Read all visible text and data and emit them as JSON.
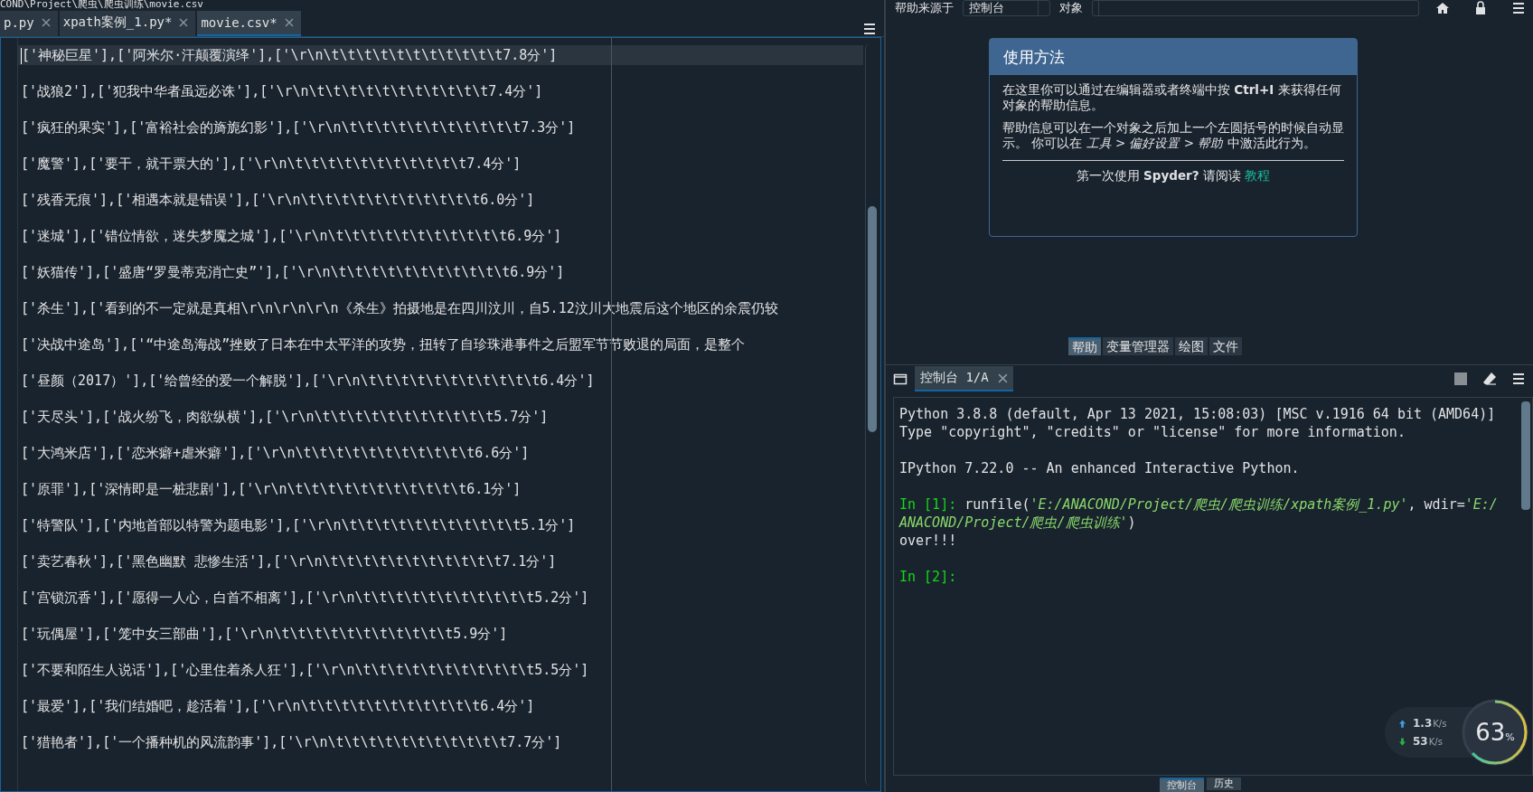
{
  "path_bar": "COND\\Project\\爬虫\\爬虫训练\\movie.csv",
  "editor": {
    "tabs": [
      {
        "label": "p.py",
        "selected": false
      },
      {
        "label": "xpath案例_1.py*",
        "selected": false
      },
      {
        "label": "movie.csv*",
        "selected": true
      }
    ],
    "lines": [
      {
        "text": "['神秘巨星'],['阿米尔·汗颠覆演绎'],['\\r\\n\\t\\t\\t\\t\\t\\t\\t\\t\\t\\t\\t7.8分']",
        "current": true
      },
      {
        "text": "['战狼2'],['犯我中华者虽远必诛'],['\\r\\n\\t\\t\\t\\t\\t\\t\\t\\t\\t\\t\\t7.4分']",
        "current": false
      },
      {
        "text": "['疯狂的果实'],['富裕社会的旖旎幻影'],['\\r\\n\\t\\t\\t\\t\\t\\t\\t\\t\\t\\t\\t7.3分']",
        "current": false
      },
      {
        "text": "['魔警'],['要干，就干票大的'],['\\r\\n\\t\\t\\t\\t\\t\\t\\t\\t\\t\\t\\t7.4分']",
        "current": false
      },
      {
        "text": "['残香无痕'],['相遇本就是错误'],['\\r\\n\\t\\t\\t\\t\\t\\t\\t\\t\\t\\t\\t6.0分']",
        "current": false
      },
      {
        "text": "['迷城'],['错位情欲，迷失梦魇之城'],['\\r\\n\\t\\t\\t\\t\\t\\t\\t\\t\\t\\t\\t6.9分']",
        "current": false
      },
      {
        "text": "['妖猫传'],['盛唐“罗曼蒂克消亡史”'],['\\r\\n\\t\\t\\t\\t\\t\\t\\t\\t\\t\\t\\t6.9分']",
        "current": false
      },
      {
        "text": "['杀生'],['看到的不一定就是真相\\r\\n\\r\\n\\r\\n《杀生》拍摄地是在四川汶川，自5.12汶川大地震后这个地区的余震仍较",
        "current": false
      },
      {
        "text": "['决战中途岛'],['“中途岛海战”挫败了日本在中太平洋的攻势，扭转了自珍珠港事件之后盟军节节败退的局面，是整个",
        "current": false
      },
      {
        "text": "['昼颜（2017）'],['给曾经的爱一个解脱'],['\\r\\n\\t\\t\\t\\t\\t\\t\\t\\t\\t\\t\\t6.4分']",
        "current": false
      },
      {
        "text": "['天尽头'],['战火纷飞，肉欲纵横'],['\\r\\n\\t\\t\\t\\t\\t\\t\\t\\t\\t\\t\\t5.7分']",
        "current": false
      },
      {
        "text": "['大鸿米店'],['恋米癖+虐米癖'],['\\r\\n\\t\\t\\t\\t\\t\\t\\t\\t\\t\\t\\t6.6分']",
        "current": false
      },
      {
        "text": "['原罪'],['深情即是一桩悲剧'],['\\r\\n\\t\\t\\t\\t\\t\\t\\t\\t\\t\\t\\t6.1分']",
        "current": false
      },
      {
        "text": "['特警队'],['内地首部以特警为题电影'],['\\r\\n\\t\\t\\t\\t\\t\\t\\t\\t\\t\\t\\t5.1分']",
        "current": false
      },
      {
        "text": "['卖艺春秋'],['黑色幽默 悲惨生活'],['\\r\\n\\t\\t\\t\\t\\t\\t\\t\\t\\t\\t\\t7.1分']",
        "current": false
      },
      {
        "text": "['宫锁沉香'],['愿得一人心，白首不相离'],['\\r\\n\\t\\t\\t\\t\\t\\t\\t\\t\\t\\t\\t5.2分']",
        "current": false
      },
      {
        "text": "['玩偶屋'],['笼中女三部曲'],['\\r\\n\\t\\t\\t\\t\\t\\t\\t\\t\\t\\t\\t5.9分']",
        "current": false
      },
      {
        "text": "['不要和陌生人说话'],['心里住着杀人狂'],['\\r\\n\\t\\t\\t\\t\\t\\t\\t\\t\\t\\t\\t5.5分']",
        "current": false
      },
      {
        "text": "['最爱'],['我们结婚吧，趁活着'],['\\r\\n\\t\\t\\t\\t\\t\\t\\t\\t\\t\\t\\t6.4分']",
        "current": false
      },
      {
        "text": "['猎艳者'],['一个播种机的风流韵事'],['\\r\\n\\t\\t\\t\\t\\t\\t\\t\\t\\t\\t\\t7.7分']",
        "current": false
      }
    ]
  },
  "help": {
    "source_label": "帮助来源于",
    "source": "控制台",
    "object_label": "对象",
    "card": {
      "title": "使用方法",
      "paragraphs": [
        "在这里你可以通过在编辑器或者终端中按 **Ctrl+I** 来获得任何对象的帮助信息。",
        "帮助信息可以在一个对象之后加上一个左圆括号的时候自动显示。 你可以在 *工具 > 偏好设置 > 帮助* 中激活此行为。"
      ],
      "footer": "第一次使用 **Spyder?** 请阅读",
      "link": "教程"
    },
    "tabs": [
      {
        "label": "帮助",
        "selected": true
      },
      {
        "label": "变量管理器",
        "selected": false
      },
      {
        "label": "绘图",
        "selected": false
      },
      {
        "label": "文件",
        "selected": false
      }
    ]
  },
  "console": {
    "tabs": [
      {
        "label": "控制台 1/A",
        "selected": true
      }
    ],
    "lines": [
      {
        "kind": "plain",
        "text": "Python 3.8.8 (default, Apr 13 2021, 15:08:03) [MSC v.1916 64 bit (AMD64)]\nType \"copyright\", \"credits\" or \"license\" for more information."
      },
      {
        "kind": "plain",
        "text": "IPython 7.22.0 -- An enhanced Interactive Python."
      },
      {
        "kind": "input",
        "prompt": "In [1]:",
        "parts": [
          {
            "kind": "code",
            "text": " runfile("
          },
          {
            "kind": "string",
            "text": "'E:/ANACOND/Project/爬虫/爬虫训练/xpath案例_1.py'"
          },
          {
            "kind": "code",
            "text": ", wdir="
          },
          {
            "kind": "string",
            "text": "'E:/ANACOND/Project/爬虫/爬虫训练'"
          },
          {
            "kind": "code",
            "text": ")"
          }
        ]
      },
      {
        "kind": "output",
        "text": "over!!!"
      },
      {
        "kind": "input",
        "prompt": "In [2]:"
      }
    ]
  },
  "bottom_tabs": [
    {
      "label": "控制台",
      "selected": true
    },
    {
      "label": "历史",
      "selected": false
    }
  ],
  "net_widget": {
    "upload": "1.3",
    "upload_unit": "K/s",
    "download": "53",
    "download_unit": "K/s",
    "percent": "63",
    "percent_sign": "%"
  }
}
